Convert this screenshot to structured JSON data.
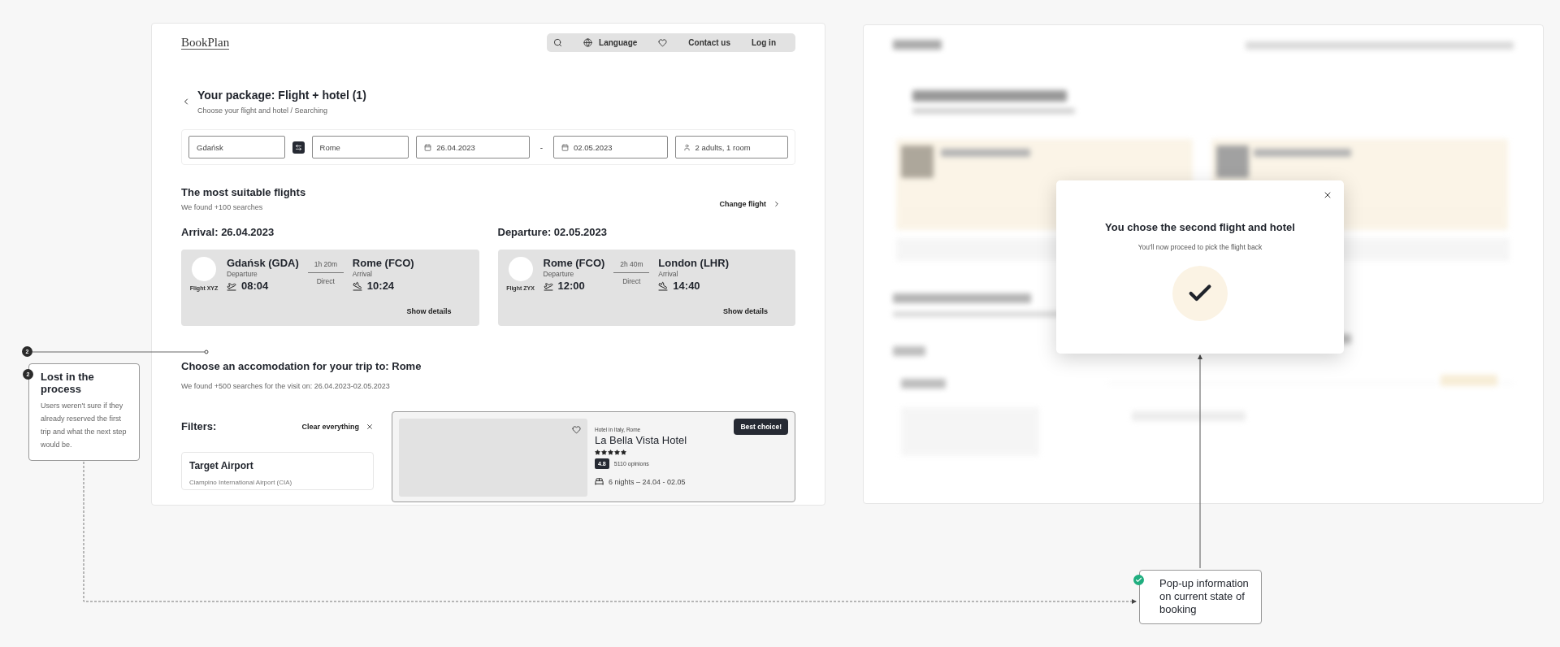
{
  "booking_screen": {
    "logo": "BookPlan",
    "nav": [
      {
        "kind": "search"
      },
      {
        "kind": "language",
        "label": "Language"
      },
      {
        "kind": "favorites"
      },
      {
        "kind": "link",
        "label": "Contact us"
      },
      {
        "kind": "link",
        "label": "Log in"
      }
    ],
    "title": "Your package: Flight + hotel (1)",
    "breadcrumb": "Choose your flight and hotel / Searching",
    "search_form": {
      "origin": "Gdańsk",
      "destination": "Rome",
      "date_from": "26.04.2023",
      "separator": "-",
      "date_to": "02.05.2023",
      "guests": "2 adults, 1 room"
    },
    "flights": {
      "title": "The most suitable flights",
      "subtitle": "We found +100 searches",
      "change_label": "Change flight",
      "legs": [
        {
          "heading": "Arrival: 26.04.2023",
          "flight": "Flight XYZ",
          "from_city": "Gdańsk (GDA)",
          "from_label": "Departure",
          "from_time": "08:04",
          "duration": "1h 20m",
          "stops": "Direct",
          "to_city": "Rome (FCO)",
          "to_label": "Arrival",
          "to_time": "10:24",
          "details": "Show details"
        },
        {
          "heading": "Departure: 02.05.2023",
          "flight": "Flight ZYX",
          "from_city": "Rome (FCO)",
          "from_label": "Departure",
          "from_time": "12:00",
          "duration": "2h 40m",
          "stops": "Direct",
          "to_city": "London (LHR)",
          "to_label": "Arrival",
          "to_time": "14:40",
          "details": "Show details"
        }
      ]
    },
    "accommodation": {
      "title": "Choose an accomodation for your trip to: Rome",
      "subtitle": "We found +500 searches for the visit on: 26.04.2023-02.05.2023",
      "filters_title": "Filters:",
      "clear_label": "Clear everything",
      "filter_card": {
        "title": "Target Airport",
        "option": "Ciampino International Airport (CIA)"
      },
      "hotel": {
        "badge": "Best choice!",
        "location": "Hotel in Italy, Rome",
        "name": "La Bella Vista Hotel",
        "stars": 5,
        "rating": "4.8",
        "opinions": "5110 opinions",
        "stay": "6 nights – 24.04 - 02.05"
      }
    }
  },
  "modal": {
    "title": "You chose the second flight and hotel",
    "message": "You'll now proceed to pick the flight back"
  },
  "notes": [
    {
      "kind": "issue",
      "marker": "2",
      "badge": "2",
      "title": "Lost in the process",
      "text": "Users weren't sure if they already reserved the first trip and what the next step would be."
    },
    {
      "kind": "resolved",
      "text": "Pop-up information on current state of booking"
    }
  ]
}
